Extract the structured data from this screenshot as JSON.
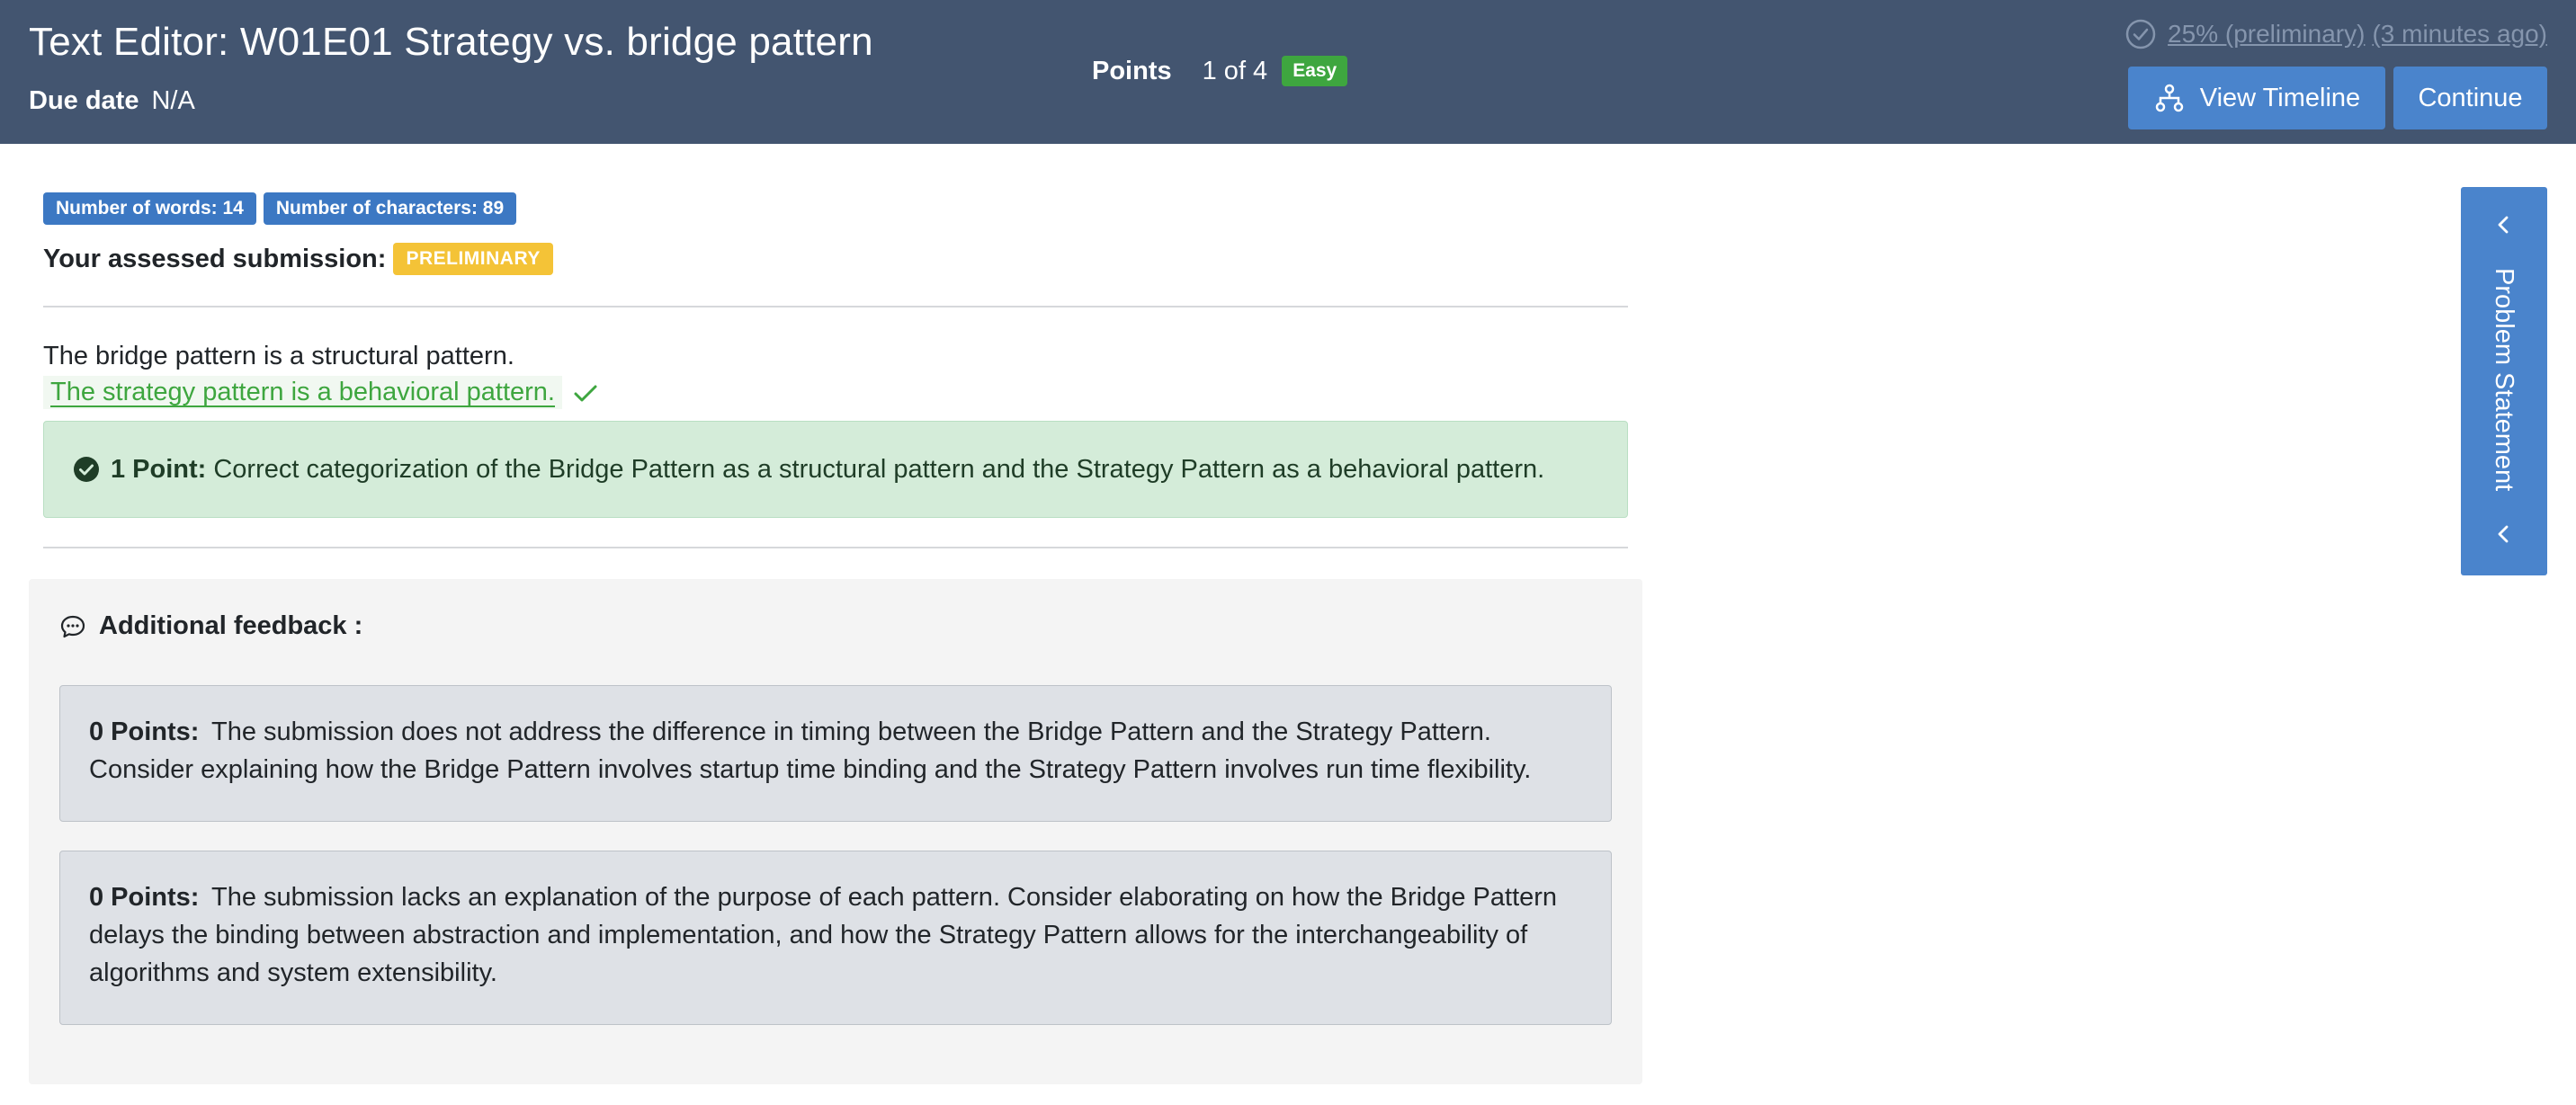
{
  "header": {
    "title": "Text Editor: W01E01 Strategy vs. bridge pattern",
    "due_label": "Due date",
    "due_value": "N/A",
    "points_label": "Points",
    "points_value": "1 of 4",
    "difficulty": "Easy",
    "status_score": "25% (preliminary)",
    "status_time": "(3 minutes ago)",
    "view_timeline_label": "View Timeline",
    "continue_label": "Continue"
  },
  "stats": {
    "words": "Number of words: 14",
    "characters": "Number of characters: 89"
  },
  "submission": {
    "heading": "Your assessed submission:",
    "badge": "PRELIMINARY",
    "line1": "The bridge pattern is a structural pattern.",
    "line2": "The strategy pattern is a behavioral pattern.",
    "feedback_points": "1 Point:",
    "feedback_text": "Correct categorization of the Bridge Pattern as a structural pattern and the Strategy Pattern as a behavioral pattern."
  },
  "additional_feedback": {
    "title": "Additional feedback :",
    "items": [
      {
        "points": "0 Points:",
        "text": "The submission does not address the difference in timing between the Bridge Pattern and the Strategy Pattern. Consider explaining how the Bridge Pattern involves startup time binding and the Strategy Pattern involves run time flexibility."
      },
      {
        "points": "0 Points:",
        "text": "The submission lacks an explanation of the purpose of each pattern. Consider elaborating on how the Bridge Pattern delays the binding between abstraction and implementation, and how the Strategy Pattern allows for the interchangeability of algorithms and system extensibility."
      }
    ]
  },
  "side_panel": {
    "label": "Problem Statement"
  },
  "colors": {
    "header_bg": "#435570",
    "primary": "#4a84cc",
    "success": "#3ea63f",
    "warning": "#f4c337",
    "success_bg": "#d4ecd9"
  },
  "icons": {
    "status": "circle-check-icon",
    "timeline": "timeline-icon",
    "correct": "check-icon",
    "feedback": "comment-icon",
    "collapse": "chevron-left-icon"
  }
}
